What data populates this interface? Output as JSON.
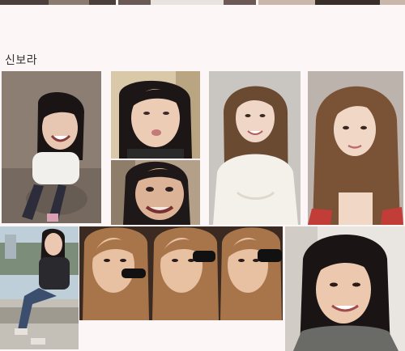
{
  "album": {
    "title": "신보라"
  },
  "photos": [
    {
      "name": "photo-top-strip-1"
    },
    {
      "name": "photo-top-strip-2"
    },
    {
      "name": "photo-top-strip-3"
    },
    {
      "name": "photo-laughing-from-above"
    },
    {
      "name": "photo-puffed-cheeks-selfie"
    },
    {
      "name": "photo-funny-face-selfie"
    },
    {
      "name": "photo-studio-smile-white-top"
    },
    {
      "name": "photo-studio-portrait-long-hair"
    },
    {
      "name": "photo-sitting-outdoors"
    },
    {
      "name": "photo-microphone-sequence"
    },
    {
      "name": "photo-close-up-smile-selfie"
    }
  ],
  "colors": {
    "background": "#fdf6f7",
    "title_text": "#333333"
  }
}
